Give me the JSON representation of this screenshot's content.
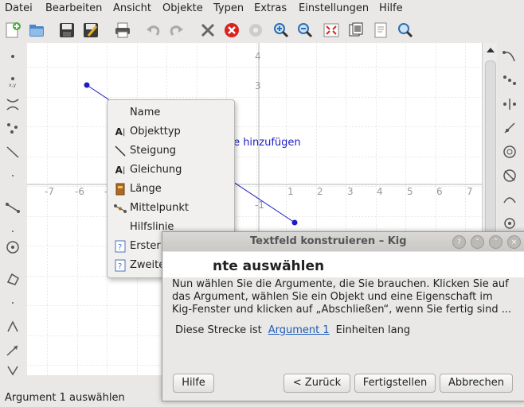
{
  "menubar": {
    "items": [
      "Datei",
      "Bearbeiten",
      "Ansicht",
      "Objekte",
      "Typen",
      "Extras",
      "Einstellungen",
      "Hilfe"
    ]
  },
  "toolbar": {
    "icons": [
      "new-document-icon",
      "open-icon",
      "save-icon",
      "save-as-icon",
      "print-icon",
      "undo-icon",
      "redo-icon",
      "delete-icon",
      "cancel-icon",
      "settings-icon",
      "zoom-in-icon",
      "zoom-out-icon",
      "fullscreen-icon",
      "fit-page-icon",
      "document-properties-icon",
      "zoom-search-icon"
    ]
  },
  "canvas": {
    "x_ticks": [
      "-7",
      "-6",
      "-5",
      "-4",
      "-3",
      "-2",
      "-1",
      "1",
      "2",
      "3",
      "4",
      "5",
      "6",
      "7"
    ],
    "y_ticks": [
      "4",
      "3",
      "2",
      "1",
      "-1"
    ],
    "hint_text": "ke hinzufügen"
  },
  "popup_menu": {
    "items": [
      {
        "label": "Name",
        "icon": ""
      },
      {
        "label": "Objekttyp",
        "icon": "text-label-icon"
      },
      {
        "label": "Steigung",
        "icon": "slope-icon"
      },
      {
        "label": "Gleichung",
        "icon": "text-label-icon"
      },
      {
        "label": "Länge",
        "icon": "length-icon"
      },
      {
        "label": "Mittelpunkt",
        "icon": "midpoint-icon"
      },
      {
        "label": "Hilfslinie",
        "icon": ""
      },
      {
        "label": "Erster Endpunkt",
        "icon": "help-icon"
      },
      {
        "label": "Zweiter Endpunkt",
        "icon": "help-icon"
      }
    ]
  },
  "dialog": {
    "title": "Textfeld konstruieren – Kig",
    "heading": "nte auswählen",
    "description": "Nun wählen Sie die Argumente, die Sie brauchen. Klicken Sie auf das Argument, wählen Sie ein Objekt und eine Eigenschaft im Kig-Fenster und klicken auf „Abschließen“, wenn Sie fertig sind ...",
    "row_prefix": "Diese Strecke ist",
    "row_link": "Argument 1",
    "row_suffix": "Einheiten lang",
    "buttons": {
      "help": "Hilfe",
      "back": "< Zurück",
      "finish": "Fertigstellen",
      "cancel": "Abbrechen"
    }
  },
  "statusbar": {
    "text": "Argument 1 auswählen"
  }
}
